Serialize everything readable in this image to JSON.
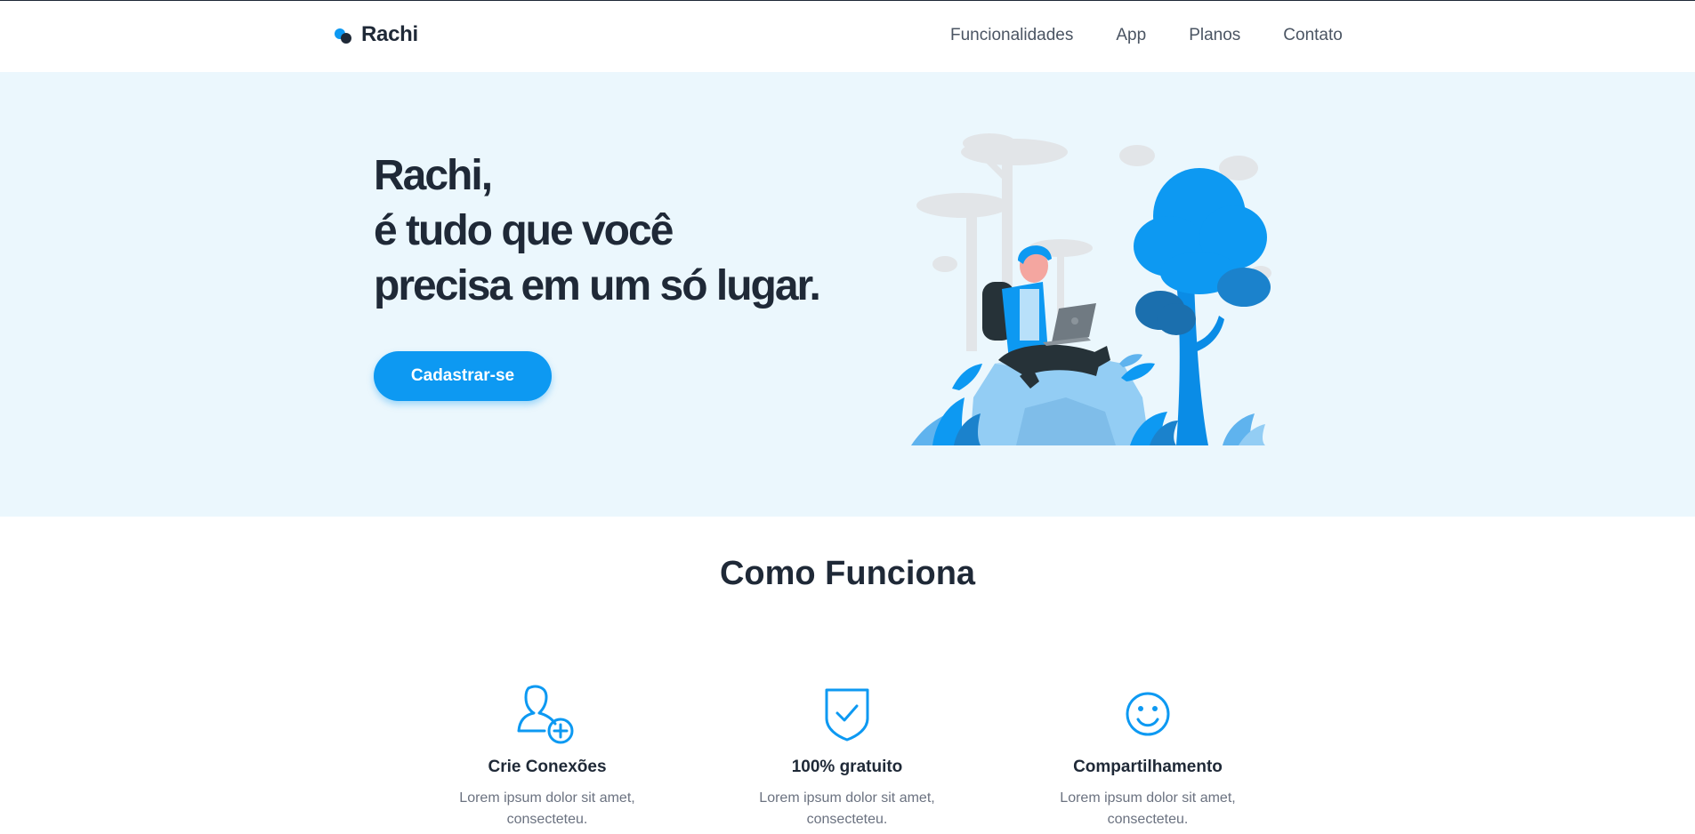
{
  "brand": {
    "name": "Rachi"
  },
  "nav": {
    "items": [
      "Funcionalidades",
      "App",
      "Planos",
      "Contato"
    ]
  },
  "hero": {
    "title_lines": [
      "Rachi,",
      "é tudo que você",
      "precisa em um só lugar."
    ],
    "cta_label": "Cadastrar-se"
  },
  "how_it_works": {
    "title": "Como Funciona",
    "features": [
      {
        "icon": "user-plus-icon",
        "title": "Crie Conexões",
        "desc_lines": [
          "Lorem ipsum dolor sit amet,",
          "consecteteu."
        ]
      },
      {
        "icon": "shield-check-icon",
        "title": "100% gratuito",
        "desc_lines": [
          "Lorem ipsum dolor sit amet,",
          "consecteteu."
        ]
      },
      {
        "icon": "smile-icon",
        "title": "Compartilhamento",
        "desc_lines": [
          "Lorem ipsum dolor sit amet,",
          "consecteteu."
        ]
      }
    ]
  },
  "colors": {
    "accent": "#0d99f2",
    "dark": "#1f2937",
    "hero_background": "#ebf7fd",
    "muted_text": "#6b7280"
  }
}
